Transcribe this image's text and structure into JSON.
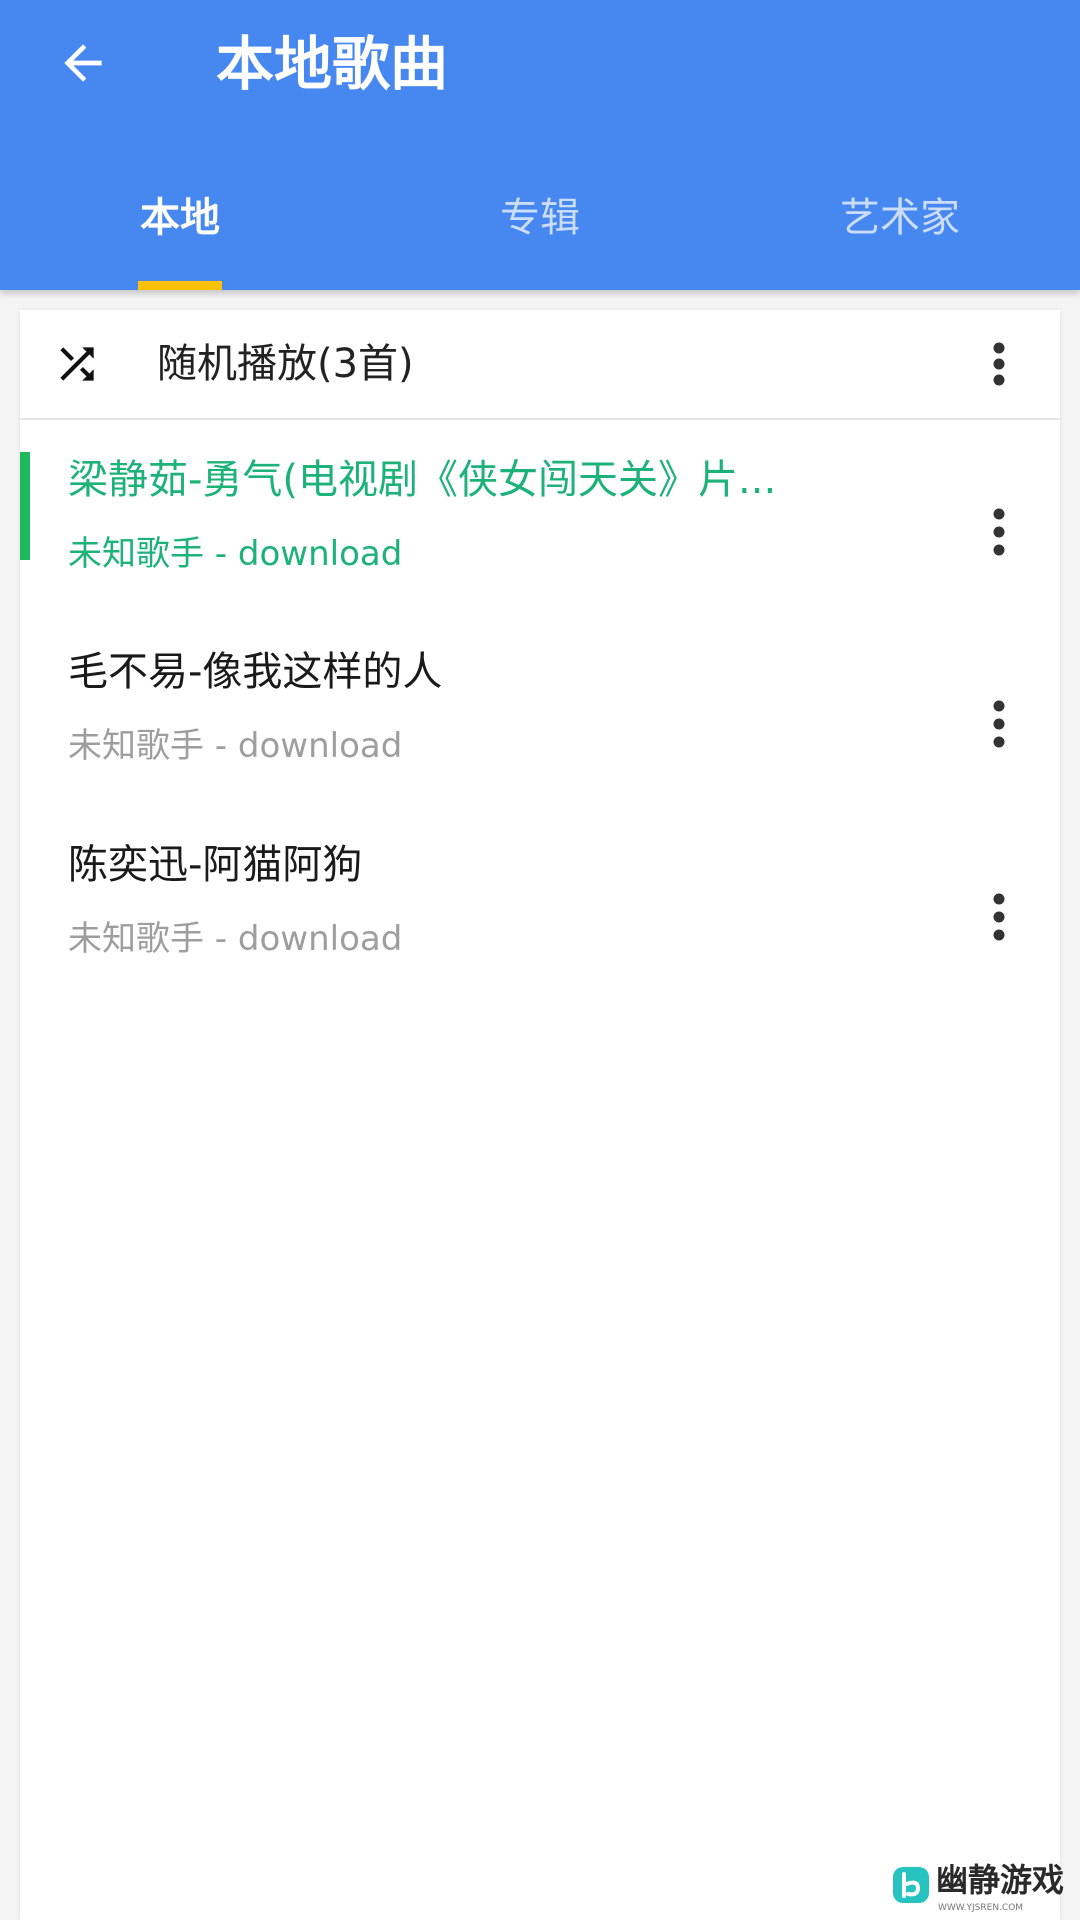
{
  "header": {
    "title": "本地歌曲",
    "back_icon": "arrow-left-icon",
    "background_color": "#4687f0"
  },
  "tabs": [
    {
      "label": "本地",
      "active": true
    },
    {
      "label": "专辑",
      "active": false
    },
    {
      "label": "艺术家",
      "active": false
    }
  ],
  "tab_indicator_color": "#ffc107",
  "shuffle": {
    "label": "随机播放(3首)",
    "icon": "shuffle-icon",
    "more_icon": "more-vertical-icon"
  },
  "songs": [
    {
      "title": "梁静茹-勇气(电视剧《侠女闯天关》片...",
      "subtitle": "未知歌手 - download",
      "playing": true,
      "more_icon": "more-vertical-icon"
    },
    {
      "title": "毛不易-像我这样的人",
      "subtitle": "未知歌手 - download",
      "playing": false,
      "more_icon": "more-vertical-icon"
    },
    {
      "title": "陈奕迅-阿猫阿狗",
      "subtitle": "未知歌手 - download",
      "playing": false,
      "more_icon": "more-vertical-icon"
    }
  ],
  "playing_color": "#1db27a",
  "watermark": {
    "text": "幽静游戏",
    "url": "WWW.YJSREN.COM"
  }
}
